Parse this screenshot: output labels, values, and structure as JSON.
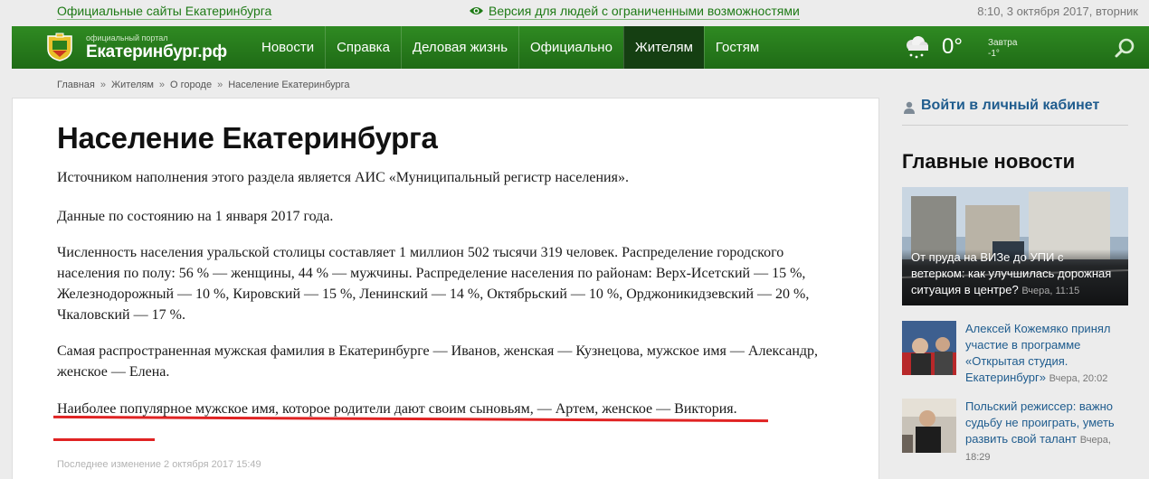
{
  "topbar": {
    "official_sites": "Официальные сайты Екатеринбурга",
    "a11y_version": "Версия для людей с ограниченными возможностями",
    "datetime": "8:10, 3 октября 2017, вторник"
  },
  "header": {
    "logo_small": "официальный портал",
    "logo_big": "Екатеринбург.рф",
    "nav": [
      "Новости",
      "Справка",
      "Деловая жизнь",
      "Официально",
      "Жителям",
      "Гостям"
    ],
    "active_nav": "Жителям",
    "temperature": "0°",
    "tomorrow_label": "Завтра",
    "tomorrow_temp": "-1°"
  },
  "breadcrumb": [
    "Главная",
    "Жителям",
    "О городе",
    "Население Екатеринбурга"
  ],
  "article": {
    "title": "Население Екатеринбурга",
    "paragraphs": [
      "Источником наполнения этого раздела является АИС «Муниципальный регистр населения».",
      "Данные по состоянию на 1 января 2017 года.",
      "Численность населения уральской столицы составляет 1 миллион 502 тысячи 319 человек. Распределение городского населения по полу: 56 % — женщины, 44 % — мужчины. Распределение населения по районам: Верх-Исетский — 15 %, Железнодорожный — 10 %, Кировский — 15 %, Ленинский — 14 %, Октябрьский — 10 %, Орджоникидзевский — 20 %, Чкаловский — 17 %.",
      "Самая распространенная мужская фамилия в Екатеринбурге — Иванов, женская — Кузнецова, мужское имя — Александр, женское — Елена.",
      "Наиболее популярное мужское имя, которое родители дают своим сыновьям, — Артем, женское — Виктория."
    ],
    "updated": "Последнее изменение 2 октября 2017 15:49"
  },
  "sidebar": {
    "login": "Войти в личный кабинет",
    "news_heading": "Главные новости",
    "news": [
      {
        "title": "От пруда на ВИЗе до УПИ с ветерком: как улучшилась дорожная ситуация в центре?",
        "time": "Вчера, 11:15"
      },
      {
        "title": "Алексей Кожемяко принял участие в программе «Открытая студия. Екатеринбург»",
        "time": "Вчера, 20:02"
      },
      {
        "title": "Польский режиссер: важно судьбу не проиграть, уметь развить свой талант",
        "time": "Вчера, 18:29"
      }
    ]
  },
  "colors": {
    "header_green": "#2a7f1e",
    "active_nav": "#153f12",
    "link_green": "#1e7a16",
    "link_blue": "#1f5c8e",
    "highlight_red": "#e02323"
  }
}
